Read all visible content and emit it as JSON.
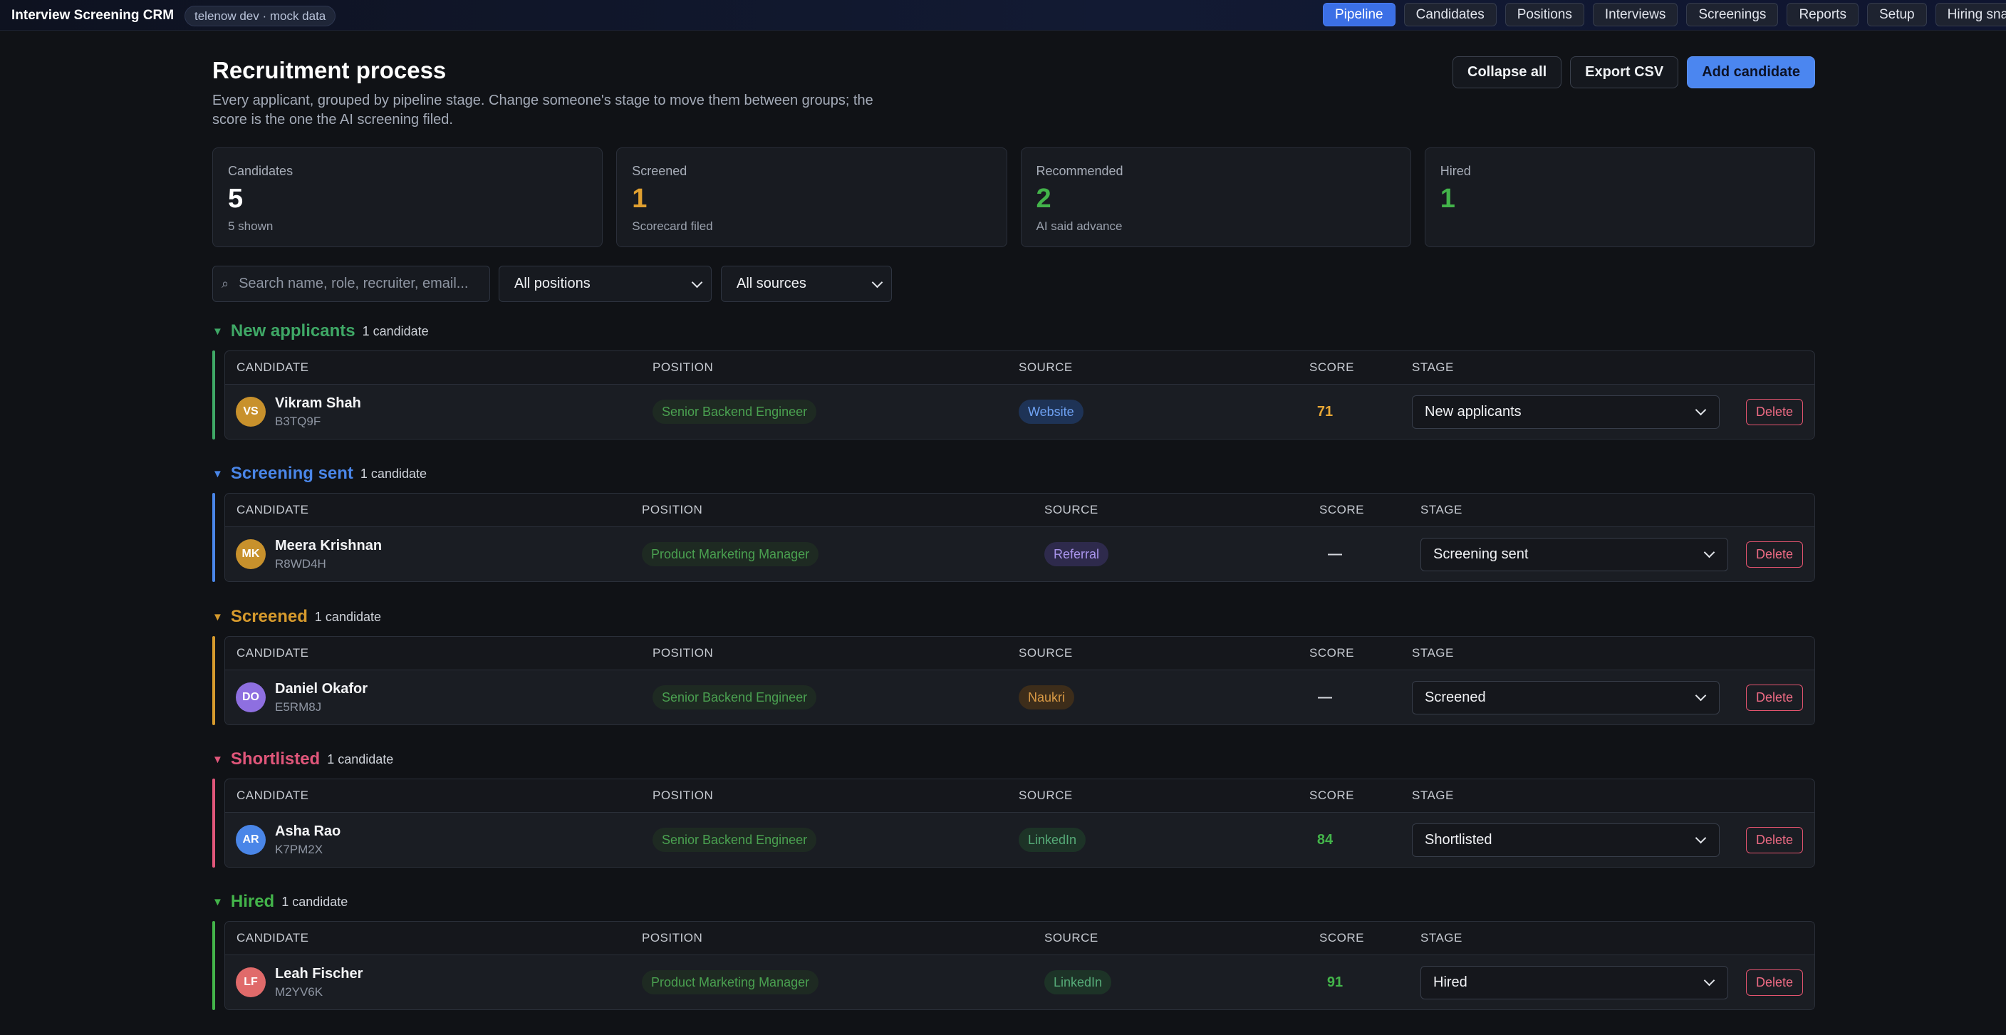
{
  "app": {
    "title": "Interview Screening CRM",
    "env": "telenow dev · mock data"
  },
  "nav": [
    {
      "label": "Pipeline",
      "active": true
    },
    {
      "label": "Candidates"
    },
    {
      "label": "Positions"
    },
    {
      "label": "Interviews"
    },
    {
      "label": "Screenings"
    },
    {
      "label": "Reports"
    },
    {
      "label": "Setup"
    },
    {
      "label": "Hiring snapshot"
    }
  ],
  "header": {
    "title": "Recruitment process",
    "description": "Every applicant, grouped by pipeline stage. Change someone's stage to move them between groups; the score is the one the AI screening filed.",
    "collapse_label": "Collapse all",
    "export_label": "Export CSV",
    "add_label": "Add candidate"
  },
  "stats": [
    {
      "label": "Candidates",
      "value": "5",
      "sub": "5 shown",
      "color": "#ffffff"
    },
    {
      "label": "Screened",
      "value": "1",
      "sub": "Scorecard filed",
      "color": "#e0a030"
    },
    {
      "label": "Recommended",
      "value": "2",
      "sub": "AI said advance",
      "color": "#43b44a"
    },
    {
      "label": "Hired",
      "value": "1",
      "sub": "",
      "color": "#43b44a"
    }
  ],
  "filters": {
    "search_placeholder": "Search name, role, recruiter, email...",
    "position_value": "All positions",
    "source_value": "All sources"
  },
  "columns": {
    "candidate": "CANDIDATE",
    "position": "POSITION",
    "source": "SOURCE",
    "score": "SCORE",
    "stage": "STAGE"
  },
  "delete_label": "Delete",
  "groups": [
    {
      "name": "New applicants",
      "count": "1 candidate",
      "color": "#3fa866",
      "row": {
        "initials": "VS",
        "avatar_color": "#c8912c",
        "name": "Vikram Shah",
        "id": "B3TQ9F",
        "position": "Senior Backend Engineer",
        "source": "Website",
        "source_style": "website",
        "score": "71",
        "score_color": "#e8a735",
        "stage": "New applicants"
      }
    },
    {
      "name": "Screening sent",
      "count": "1 candidate",
      "color": "#4a86e8",
      "row": {
        "initials": "MK",
        "avatar_color": "#c8912c",
        "name": "Meera Krishnan",
        "id": "R8WD4H",
        "position": "Product Marketing Manager",
        "source": "Referral",
        "source_style": "referral",
        "score": "—",
        "score_color": "#d5d8de",
        "stage": "Screening sent"
      }
    },
    {
      "name": "Screened",
      "count": "1 candidate",
      "color": "#d69a2d",
      "row": {
        "initials": "DO",
        "avatar_color": "#8e6fe0",
        "name": "Daniel Okafor",
        "id": "E5RM8J",
        "position": "Senior Backend Engineer",
        "source": "Naukri",
        "source_style": "naukri",
        "score": "—",
        "score_color": "#d5d8de",
        "stage": "Screened"
      }
    },
    {
      "name": "Shortlisted",
      "count": "1 candidate",
      "color": "#e0567a",
      "row": {
        "initials": "AR",
        "avatar_color": "#4a86e8",
        "name": "Asha Rao",
        "id": "K7PM2X",
        "position": "Senior Backend Engineer",
        "source": "LinkedIn",
        "source_style": "linkedin",
        "score": "84",
        "score_color": "#43b44a",
        "stage": "Shortlisted"
      }
    },
    {
      "name": "Hired",
      "count": "1 candidate",
      "color": "#43b44a",
      "row": {
        "initials": "LF",
        "avatar_color": "#e06a6a",
        "name": "Leah Fischer",
        "id": "M2YV6K",
        "position": "Product Marketing Manager",
        "source": "LinkedIn",
        "source_style": "linkedin",
        "score": "91",
        "score_color": "#43b44a",
        "stage": "Hired"
      }
    }
  ]
}
